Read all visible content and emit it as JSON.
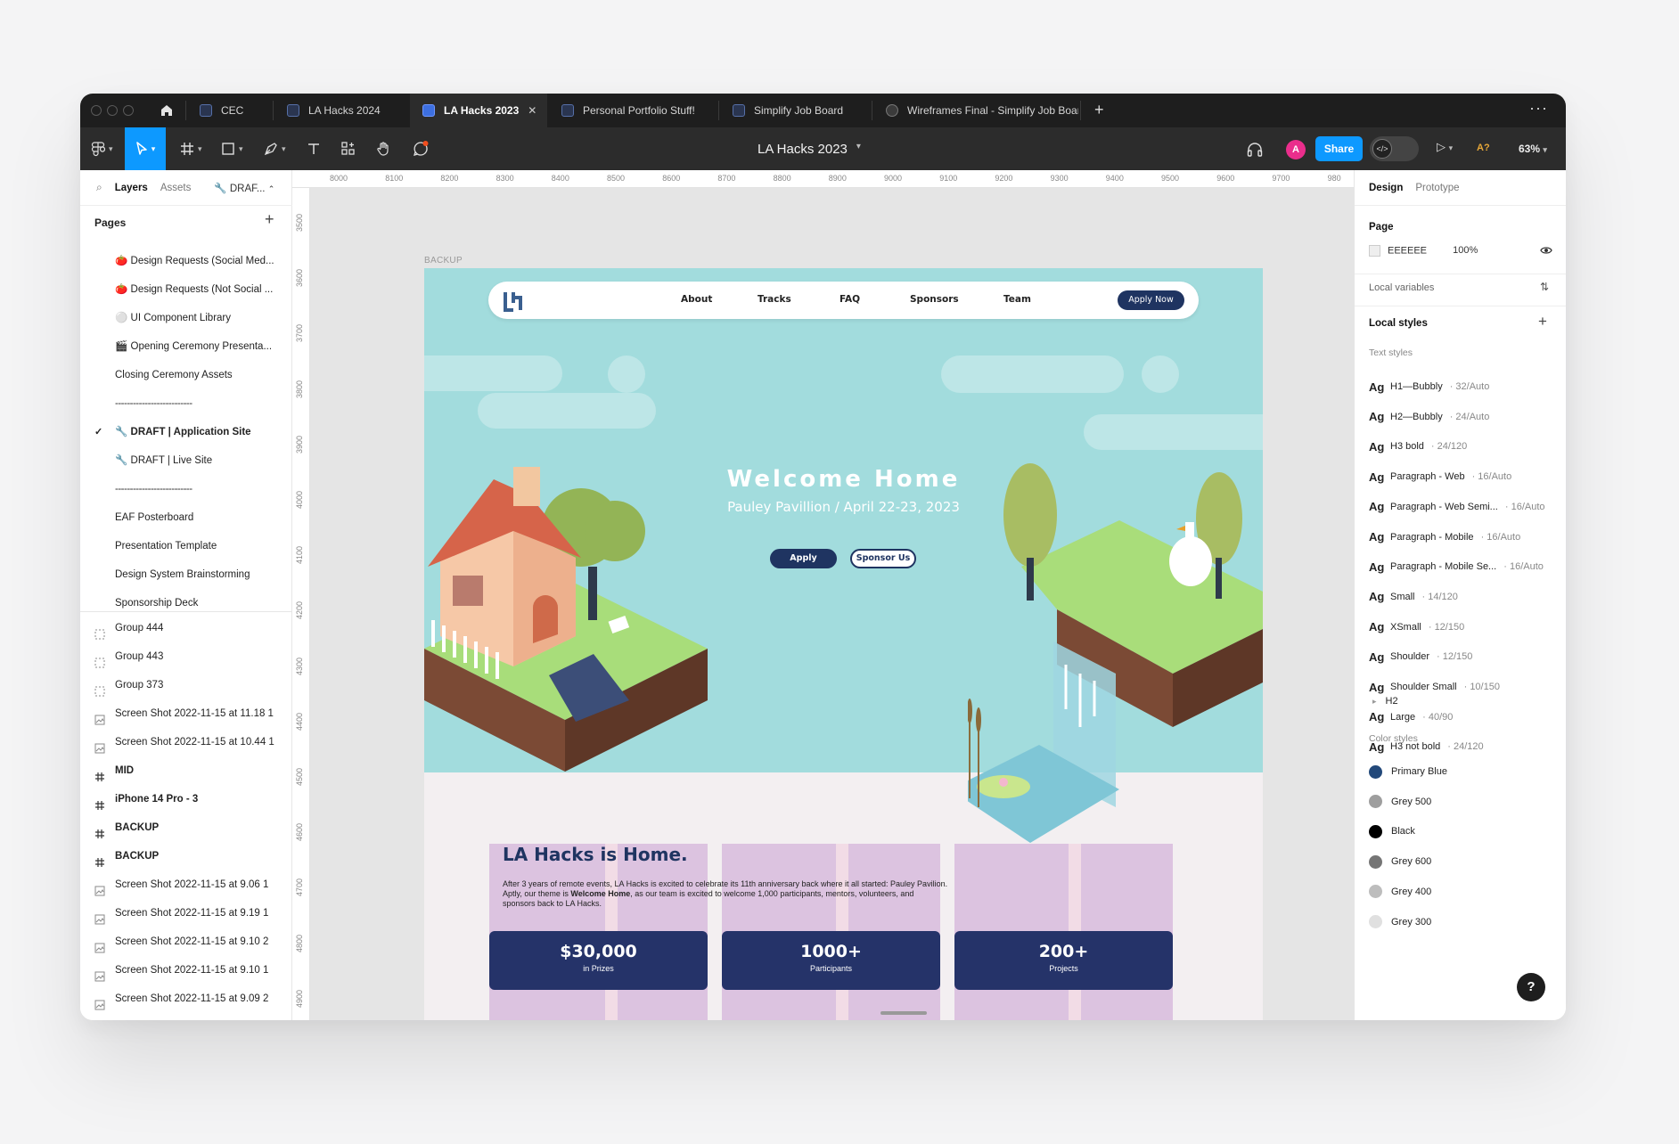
{
  "tabs": [
    {
      "label": "CEC"
    },
    {
      "label": "LA Hacks 2024"
    },
    {
      "label": "LA Hacks 2023",
      "active": true
    },
    {
      "label": "Personal Portfolio Stuff!"
    },
    {
      "label": "Simplify Job Board"
    },
    {
      "label": "Wireframes Final - Simplify Job Board"
    }
  ],
  "toolbar": {
    "doc_title": "LA Hacks 2023",
    "avatar_initial": "A",
    "share_label": "Share",
    "dev_label": "</>",
    "warn_label": "A?",
    "zoom_label": "63%"
  },
  "left_panel": {
    "tab_layers": "Layers",
    "tab_assets": "Assets",
    "branch_label": "DRAF...",
    "pages_heading": "Pages",
    "pages": [
      "🍅 Design Requests (Social Med...",
      "🍅 Design Requests (Not Social ...",
      "⚪ UI Component Library",
      "🎬 Opening Ceremony Presenta...",
      "Closing Ceremony Assets",
      "--------------------------",
      "🔧 DRAFT | Application Site",
      "🔧 DRAFT | Live Site",
      "--------------------------",
      "EAF Posterboard",
      "Presentation Template",
      "Design System Brainstorming",
      "Sponsorship Deck"
    ],
    "current_page_index": 6,
    "layers": [
      {
        "name": "Group 444",
        "icon": "group"
      },
      {
        "name": "Group 443",
        "icon": "group"
      },
      {
        "name": "Group 373",
        "icon": "group"
      },
      {
        "name": "Screen Shot 2022-11-15 at 11.18 1",
        "icon": "image"
      },
      {
        "name": "Screen Shot 2022-11-15 at 10.44 1",
        "icon": "image"
      },
      {
        "name": "MID",
        "icon": "frame"
      },
      {
        "name": "iPhone 14 Pro - 3",
        "icon": "frame"
      },
      {
        "name": "BACKUP",
        "icon": "frame"
      },
      {
        "name": "BACKUP",
        "icon": "frame"
      },
      {
        "name": "Screen Shot 2022-11-15 at 9.06 1",
        "icon": "image"
      },
      {
        "name": "Screen Shot 2022-11-15 at 9.19 1",
        "icon": "image"
      },
      {
        "name": "Screen Shot 2022-11-15 at 9.10 2",
        "icon": "image"
      },
      {
        "name": "Screen Shot 2022-11-15 at 9.10 1",
        "icon": "image"
      },
      {
        "name": "Screen Shot 2022-11-15 at 9.09 2",
        "icon": "image"
      },
      {
        "name": "Screen Shot 2022-11-15 at 9.09 1",
        "icon": "image"
      }
    ]
  },
  "ruler": {
    "top": [
      "8000",
      "8100",
      "8200",
      "8300",
      "8400",
      "8500",
      "8600",
      "8700",
      "8800",
      "8900",
      "9000",
      "9100",
      "9200",
      "9300",
      "9400",
      "9500",
      "9600",
      "9700",
      "980"
    ],
    "left": [
      "3500",
      "3600",
      "3700",
      "3800",
      "3900",
      "4000",
      "4100",
      "4200",
      "4300",
      "4400",
      "4500",
      "4600",
      "4700",
      "4800",
      "4900"
    ]
  },
  "canvas": {
    "frame_label": "BACKUP",
    "nav": [
      "About",
      "Tracks",
      "FAQ",
      "Sponsors",
      "Team"
    ],
    "nav_cta": "Apply Now",
    "hero_title": "Welcome Home",
    "hero_subtitle": "Pauley Pavillion / April 22-23, 2023",
    "hero_btn_apply": "Apply",
    "hero_btn_sponsor": "Sponsor Us",
    "about_heading": "LA Hacks is Home.",
    "about_text_pre": "After 3 years of remote events, LA Hacks is excited to celebrate its 11th anniversary back where it all started: Pauley Pavilion. Aptly, our theme is ",
    "about_text_bold": "Welcome Home",
    "about_text_post": ", as our team is excited to welcome 1,000 participants, mentors, volunteers, and sponsors back to LA Hacks.",
    "stats": [
      {
        "value": "$30,000",
        "label": "in Prizes"
      },
      {
        "value": "1000+",
        "label": "Participants"
      },
      {
        "value": "200+",
        "label": "Projects"
      }
    ]
  },
  "right_panel": {
    "tab_design": "Design",
    "tab_prototype": "Prototype",
    "page_heading": "Page",
    "page_color": "EEEEEE",
    "page_opacity": "100%",
    "local_variables": "Local variables",
    "local_styles": "Local styles",
    "text_styles_heading": "Text styles",
    "text_styles": [
      {
        "name": "H1—Bubbly",
        "meta": "· 32/Auto"
      },
      {
        "name": "H2—Bubbly",
        "meta": "· 24/Auto"
      },
      {
        "name": "H3 bold",
        "meta": "· 24/120"
      },
      {
        "name": "Paragraph - Web",
        "meta": "· 16/Auto"
      },
      {
        "name": "Paragraph - Web Semi...",
        "meta": "· 16/Auto"
      },
      {
        "name": "Paragraph - Mobile",
        "meta": "· 16/Auto"
      },
      {
        "name": "Paragraph - Mobile Se...",
        "meta": "· 16/Auto"
      },
      {
        "name": "Small",
        "meta": "· 14/120"
      },
      {
        "name": "XSmall",
        "meta": "· 12/150"
      },
      {
        "name": "Shoulder",
        "meta": "· 12/150"
      },
      {
        "name": "Shoulder Small",
        "meta": "· 10/150"
      },
      {
        "name": "Large",
        "meta": "· 40/90"
      },
      {
        "name": "H3 not bold",
        "meta": "· 24/120"
      }
    ],
    "text_group": "H2",
    "color_styles_heading": "Color styles",
    "color_styles": [
      {
        "name": "Primary Blue",
        "color": "#23497a"
      },
      {
        "name": "Grey 500",
        "color": "#9e9e9e"
      },
      {
        "name": "Black",
        "color": "#000000"
      },
      {
        "name": "Grey 600",
        "color": "#757575"
      },
      {
        "name": "Grey 400",
        "color": "#bdbdbd"
      },
      {
        "name": "Grey 300",
        "color": "#e0e0e0"
      }
    ],
    "help_label": "?"
  }
}
